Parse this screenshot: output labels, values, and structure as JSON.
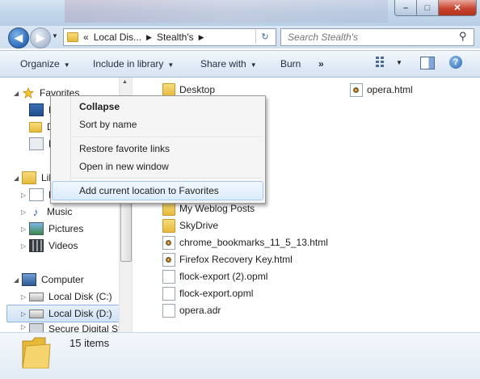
{
  "window": {
    "minimize": "–",
    "maximize": "□",
    "close": "✕"
  },
  "nav": {
    "back_arrow": "◀",
    "forward_arrow": "▶",
    "history_caret": "▼",
    "breadcrumb_lead": "«",
    "breadcrumb": [
      "Local Dis...",
      "Stealth's"
    ],
    "breadcrumb_sep": "▶",
    "refresh_glyph": "↻",
    "search_placeholder": "Search Stealth's",
    "search_glyph": "⚲"
  },
  "toolbar": {
    "organize": "Organize",
    "include_in_library": "Include in library",
    "share_with": "Share with",
    "burn": "Burn",
    "more": "»",
    "caret": "▼",
    "help": "?"
  },
  "nav_pane": {
    "favorites": "Favorites",
    "fav_children": [
      "D",
      "D",
      "R"
    ],
    "libraries": "Libr",
    "lib_children": [
      "D",
      "Music",
      "Pictures",
      "Videos"
    ],
    "computer": "Computer",
    "drives": [
      "Local Disk (C:)",
      "Local Disk (D:)",
      "Secure Digital St"
    ],
    "expand_collapsed": "▷",
    "expand_open": "◢",
    "scroll_up": "▲"
  },
  "files": {
    "col1_top": [
      "Desktop"
    ],
    "col1": [
      "My Weblog Posts",
      "SkyDrive",
      "chrome_bookmarks_11_5_13.html",
      "Firefox Recovery Key.html",
      "flock-export (2).opml",
      "flock-export.opml",
      "opera.adr"
    ],
    "col2": [
      "opera.html"
    ]
  },
  "context_menu": {
    "collapse": "Collapse",
    "sort_by_name": "Sort by name",
    "restore_favorite_links": "Restore favorite links",
    "open_in_new_window": "Open in new window",
    "add_current_location": "Add current location to Favorites"
  },
  "details": {
    "item_count": "15 items"
  }
}
